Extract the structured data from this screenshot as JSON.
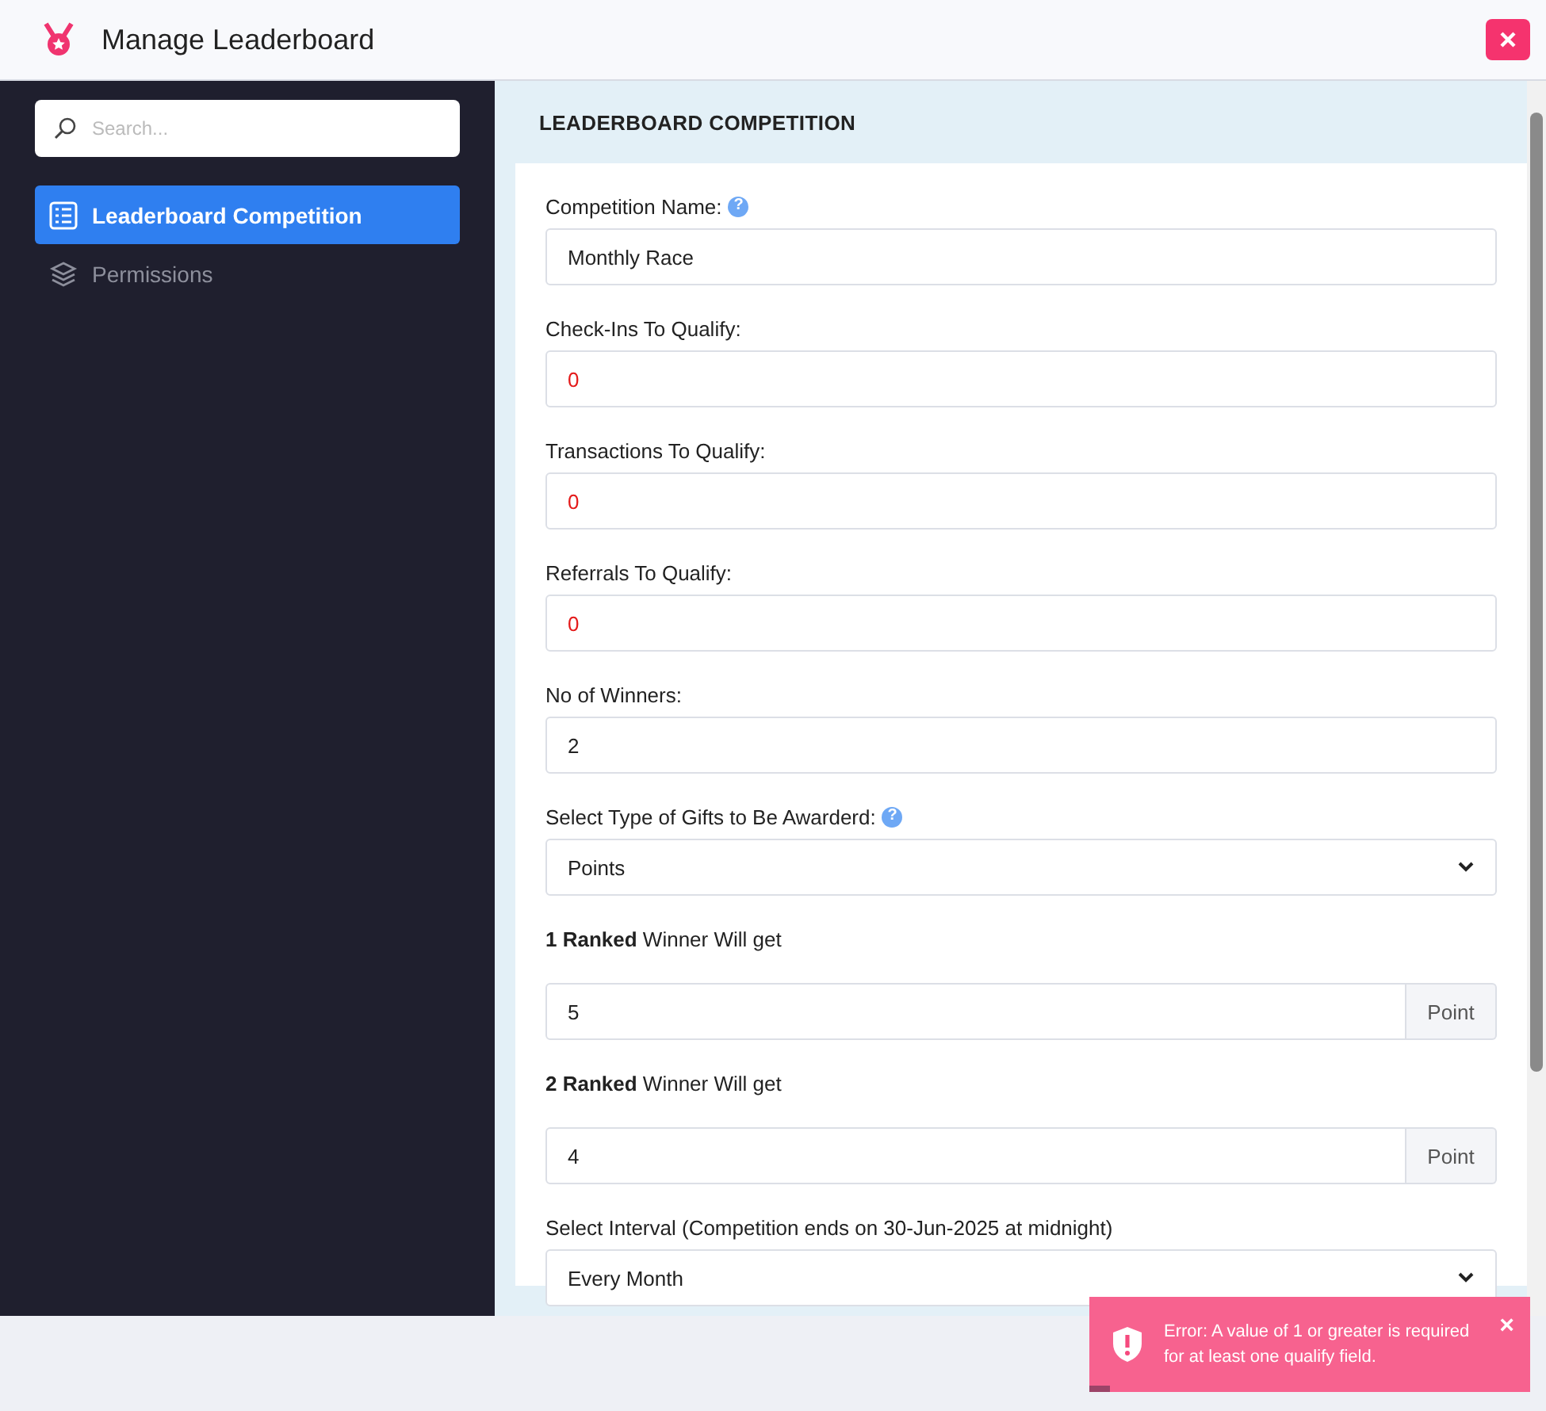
{
  "window": {
    "title": "Manage Leaderboard"
  },
  "sidebar": {
    "search": {
      "placeholder": "Search..."
    },
    "items": [
      {
        "label": "Leaderboard Competition",
        "selected": true
      },
      {
        "label": "Permissions",
        "selected": false
      }
    ]
  },
  "panel": {
    "title": "LEADERBOARD COMPETITION",
    "fields": [
      {
        "kind": "text",
        "label": "Competition Name:",
        "help": "?",
        "value": "Monthly Race",
        "invalid": false
      },
      {
        "kind": "text",
        "label": "Check-Ins To Qualify:",
        "value": "0",
        "invalid": true
      },
      {
        "kind": "text",
        "label": "Transactions To Qualify:",
        "value": "0",
        "invalid": true
      },
      {
        "kind": "text",
        "label": "Referrals To Qualify:",
        "value": "0",
        "invalid": true
      },
      {
        "kind": "text",
        "label": "No of Winners:",
        "value": "2",
        "invalid": false
      },
      {
        "kind": "select",
        "label": "Select Type of Gifts to Be Awarderd:",
        "help": "?",
        "value": "Points"
      },
      {
        "kind": "addon",
        "label": "**1 Ranked** Winner Will get",
        "value": "5",
        "addon": "Point"
      },
      {
        "kind": "addon",
        "label": "**2 Ranked** Winner Will get",
        "value": "4",
        "addon": "Point"
      },
      {
        "kind": "select",
        "label": "Select Interval (Competition ends on 30-Jun-2025 at midnight)",
        "value": "Every Month"
      }
    ]
  },
  "toast": {
    "message": "Error: A value of 1 or greater is required for at least one qualify field.",
    "close": "×"
  }
}
